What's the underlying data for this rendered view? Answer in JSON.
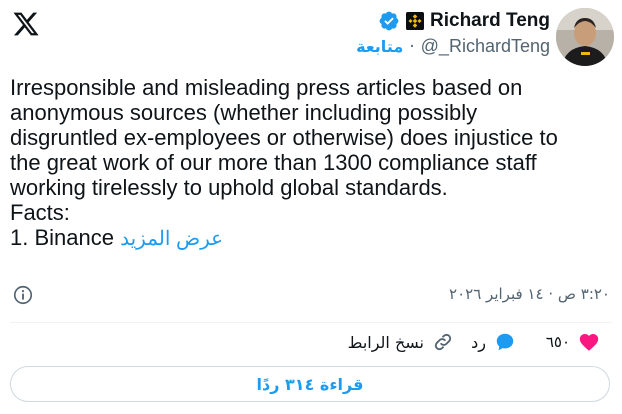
{
  "header": {
    "author_name": "Richard Teng",
    "handle": "@_RichardTeng",
    "follow_label": "متابعة",
    "separator": "·"
  },
  "tweet": {
    "text": "Irresponsible and misleading press articles based on\nanonymous sources (whether including possibly\ndisgruntled ex-employees or otherwise) does injustice to\nthe great work of our more than 1300 compliance staff\nworking tirelessly to uphold global standards.\nFacts:\n1. Binance",
    "show_more": "عرض المزيد",
    "timestamp": "٣:٢٠ ص · ١٤ فبراير ٢٠٢٦"
  },
  "actions": {
    "like_count": "٦٥٠",
    "reply_label": "رد",
    "copy_link_label": "نسخ الرابط"
  },
  "read_replies_label": "قراءة ٣١٤ ردًا",
  "colors": {
    "accent": "#1d9bf0",
    "like": "#f91880",
    "muted": "#536471",
    "binance": "#f0b90b"
  },
  "icons": [
    "x-logo-icon",
    "verified-badge-icon",
    "binance-affiliate-icon",
    "info-icon",
    "heart-icon",
    "reply-bubble-icon",
    "link-icon"
  ]
}
